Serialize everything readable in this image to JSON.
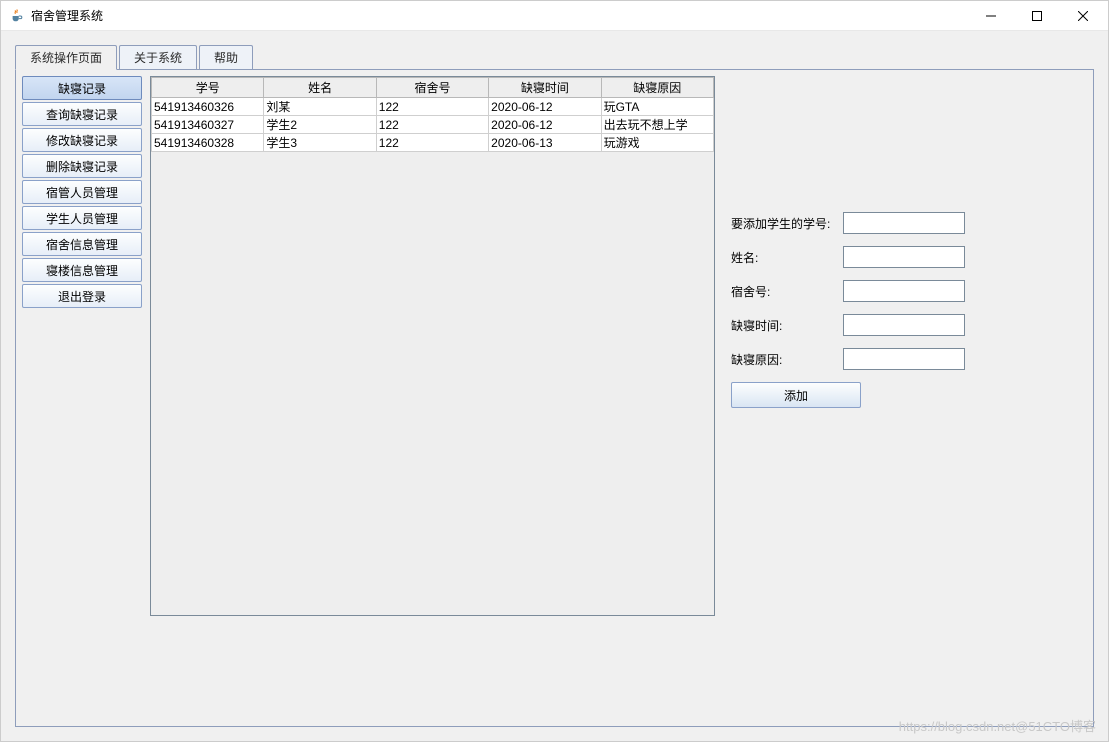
{
  "window": {
    "title": "宿舍管理系统"
  },
  "tabs": [
    {
      "label": "系统操作页面",
      "active": true
    },
    {
      "label": "关于系统",
      "active": false
    },
    {
      "label": "帮助",
      "active": false
    }
  ],
  "sidebar": {
    "items": [
      {
        "label": "缺寝记录",
        "active": true
      },
      {
        "label": "查询缺寝记录",
        "active": false
      },
      {
        "label": "修改缺寝记录",
        "active": false
      },
      {
        "label": "删除缺寝记录",
        "active": false
      },
      {
        "label": "宿管人员管理",
        "active": false
      },
      {
        "label": "学生人员管理",
        "active": false
      },
      {
        "label": "宿舍信息管理",
        "active": false
      },
      {
        "label": "寝楼信息管理",
        "active": false
      },
      {
        "label": "退出登录",
        "active": false
      }
    ]
  },
  "table": {
    "headers": [
      "学号",
      "姓名",
      "宿舍号",
      "缺寝时间",
      "缺寝原因"
    ],
    "rows": [
      [
        "541913460326",
        "刘某",
        "122",
        "2020-06-12",
        "玩GTA"
      ],
      [
        "541913460327",
        "学生2",
        "122",
        "2020-06-12",
        "出去玩不想上学"
      ],
      [
        "541913460328",
        "学生3",
        "122",
        "2020-06-13",
        "玩游戏"
      ]
    ]
  },
  "form": {
    "fields": [
      {
        "label": "要添加学生的学号:",
        "value": ""
      },
      {
        "label": "姓名:",
        "value": ""
      },
      {
        "label": "宿舍号:",
        "value": ""
      },
      {
        "label": "缺寝时间:",
        "value": ""
      },
      {
        "label": "缺寝原因:",
        "value": ""
      }
    ],
    "submit_label": "添加"
  },
  "watermark": "https://blog.csdn.net@51CTO博客"
}
